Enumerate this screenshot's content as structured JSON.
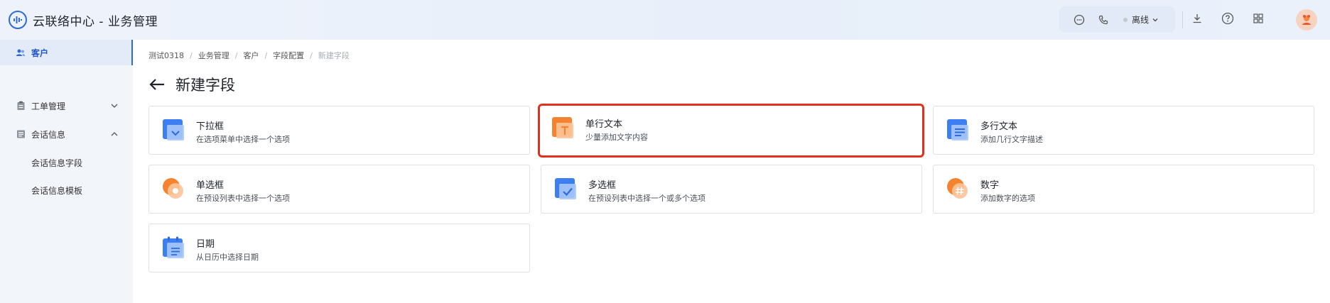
{
  "header": {
    "app_title": "云联络中心 - 业务管理",
    "status_label": "离线"
  },
  "sidebar": {
    "items": [
      {
        "label": "客户",
        "active": true
      },
      {
        "label": "工单管理",
        "expanded": false
      },
      {
        "label": "会话信息",
        "expanded": true
      },
      {
        "label": "会话信息字段"
      },
      {
        "label": "会话信息模板"
      }
    ]
  },
  "breadcrumb": [
    "测试0318",
    "业务管理",
    "客户",
    "字段配置",
    "新建字段"
  ],
  "page": {
    "title": "新建字段"
  },
  "field_types": [
    {
      "title": "下拉框",
      "desc": "在选项菜单中选择一个选项",
      "icon": "dropdown-icon",
      "color": "#3d7ef0"
    },
    {
      "title": "单行文本",
      "desc": "少量添加文字内容",
      "icon": "single-line-text-icon",
      "color": "#f5822f",
      "selected": true
    },
    {
      "title": "多行文本",
      "desc": "添加几行文字描述",
      "icon": "multi-line-text-icon",
      "color": "#3d7ef0"
    },
    {
      "title": "单选框",
      "desc": "在预设列表中选择一个选项",
      "icon": "radio-icon",
      "color": "#f5822f"
    },
    {
      "title": "多选框",
      "desc": "在预设列表中选择一个或多个选项",
      "icon": "checkbox-icon",
      "color": "#3d7ef0"
    },
    {
      "title": "数字",
      "desc": "添加数字的选项",
      "icon": "number-icon",
      "color": "#f5822f"
    },
    {
      "title": "日期",
      "desc": "从日历中选择日期",
      "icon": "date-icon",
      "color": "#3d7ef0"
    }
  ],
  "colors": {
    "accent": "#2e6bd8",
    "highlight": "#e0301e"
  }
}
